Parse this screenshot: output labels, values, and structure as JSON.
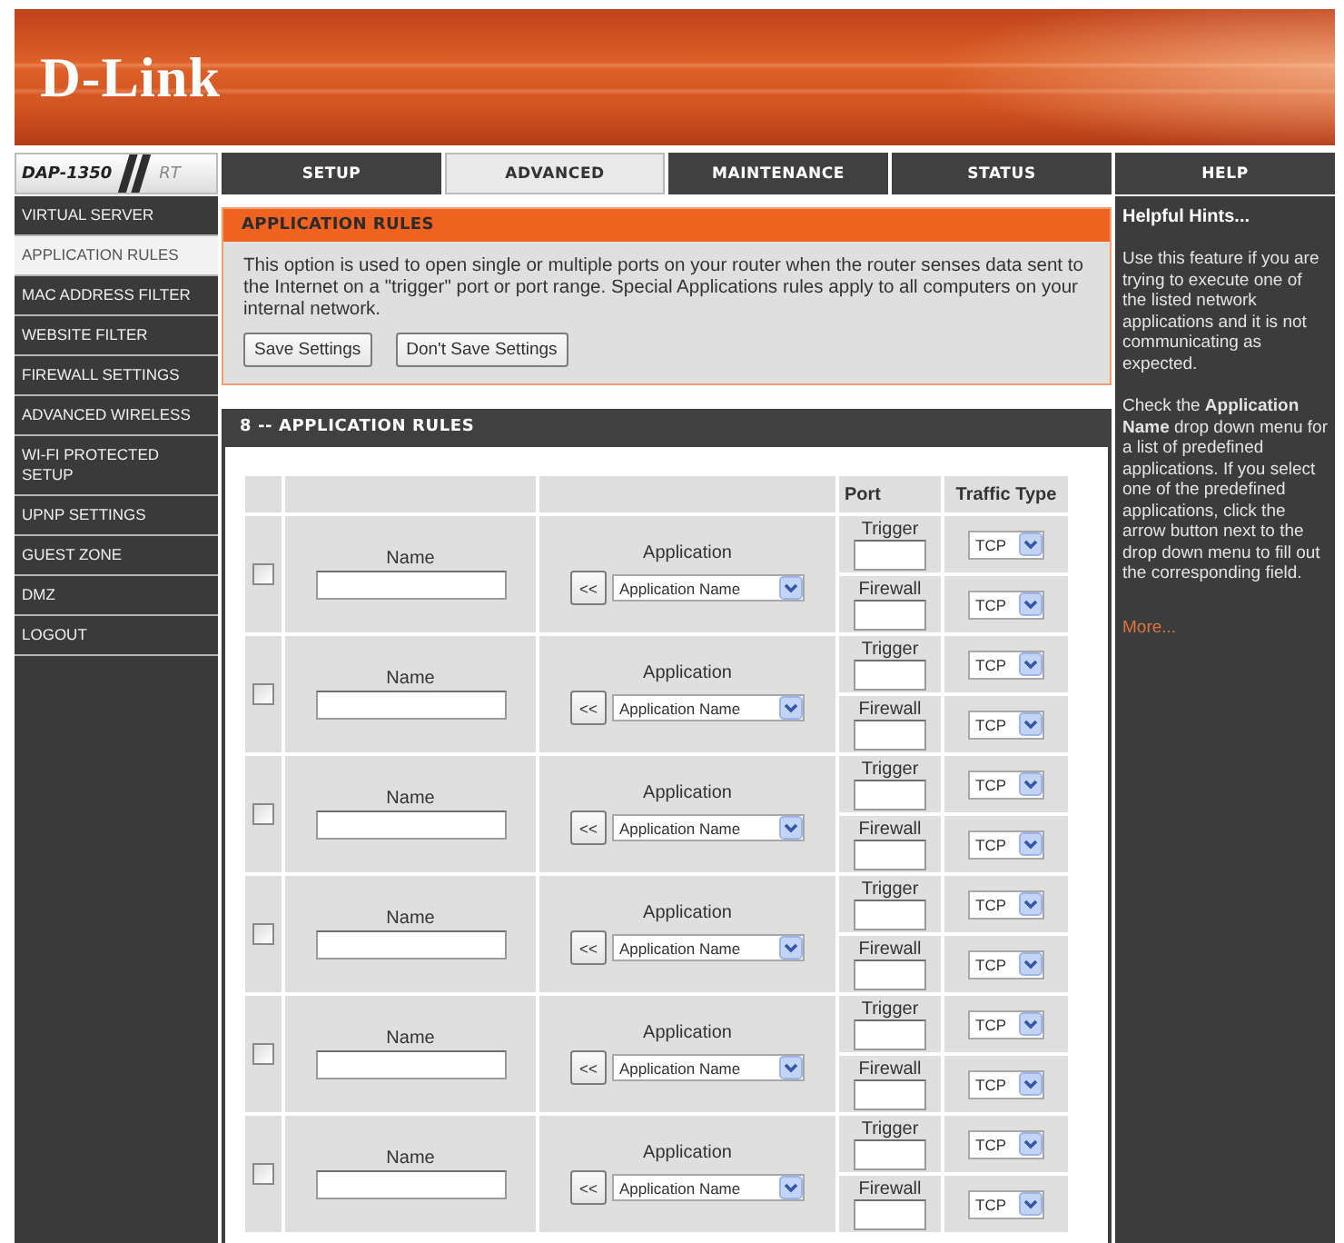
{
  "header": {
    "logo": "D-Link"
  },
  "model": {
    "name": "DAP-1350",
    "suffix": "RT"
  },
  "tabs": [
    {
      "label": "SETUP",
      "selected": false
    },
    {
      "label": "ADVANCED",
      "selected": true
    },
    {
      "label": "MAINTENANCE",
      "selected": false
    },
    {
      "label": "STATUS",
      "selected": false
    },
    {
      "label": "HELP",
      "selected": false
    }
  ],
  "sidebar": {
    "items": [
      {
        "label": "VIRTUAL SERVER",
        "selected": false
      },
      {
        "label": "APPLICATION RULES",
        "selected": true
      },
      {
        "label": "MAC ADDRESS FILTER",
        "selected": false
      },
      {
        "label": "WEBSITE FILTER",
        "selected": false
      },
      {
        "label": "FIREWALL SETTINGS",
        "selected": false
      },
      {
        "label": "ADVANCED WIRELESS",
        "selected": false
      },
      {
        "label": "WI-FI PROTECTED SETUP",
        "selected": false
      },
      {
        "label": "UPNP SETTINGS",
        "selected": false
      },
      {
        "label": "GUEST ZONE",
        "selected": false
      },
      {
        "label": "DMZ",
        "selected": false
      },
      {
        "label": "LOGOUT",
        "selected": false
      }
    ]
  },
  "intro": {
    "title": "APPLICATION RULES",
    "text": "This option is used to open single or multiple ports on your router when the router senses data sent to the Internet on a \"trigger\" port or port range. Special Applications rules apply to all computers on your internal network.",
    "buttons": [
      "Save Settings",
      "Don't Save Settings"
    ]
  },
  "rules": {
    "title": "8 -- APPLICATION RULES",
    "columns": {
      "port": "Port",
      "traffic_type": "Traffic Type"
    },
    "rows": [
      {
        "checked": false,
        "name_label": "Name",
        "application_label": "Application",
        "fill_button": "<<",
        "application": "Application Name",
        "trigger_label": "Trigger",
        "firewall_label": "Firewall",
        "trigger_protocol": "TCP",
        "firewall_protocol": "TCP"
      },
      {
        "checked": false,
        "name_label": "Name",
        "application_label": "Application",
        "fill_button": "<<",
        "application": "Application Name",
        "trigger_label": "Trigger",
        "firewall_label": "Firewall",
        "trigger_protocol": "TCP",
        "firewall_protocol": "TCP"
      },
      {
        "checked": false,
        "name_label": "Name",
        "application_label": "Application",
        "fill_button": "<<",
        "application": "Application Name",
        "trigger_label": "Trigger",
        "firewall_label": "Firewall",
        "trigger_protocol": "TCP",
        "firewall_protocol": "TCP"
      },
      {
        "checked": false,
        "name_label": "Name",
        "application_label": "Application",
        "fill_button": "<<",
        "application": "Application Name",
        "trigger_label": "Trigger",
        "firewall_label": "Firewall",
        "trigger_protocol": "TCP",
        "firewall_protocol": "TCP"
      },
      {
        "checked": false,
        "name_label": "Name",
        "application_label": "Application",
        "fill_button": "<<",
        "application": "Application Name",
        "trigger_label": "Trigger",
        "firewall_label": "Firewall",
        "trigger_protocol": "TCP",
        "firewall_protocol": "TCP"
      },
      {
        "checked": false,
        "name_label": "Name",
        "application_label": "Application",
        "fill_button": "<<",
        "application": "Application Name",
        "trigger_label": "Trigger",
        "firewall_label": "Firewall",
        "trigger_protocol": "TCP",
        "firewall_protocol": "TCP"
      }
    ]
  },
  "help": {
    "title": "Helpful Hints...",
    "paragraphs": [
      "Use this feature if you are trying to execute one of the listed network applications and it is not communicating as expected.",
      "Check the **Application Name** drop down menu for a list of predefined applications. If you select one of the predefined applications, click the arrow button next to the drop down menu to fill out the corresponding field."
    ],
    "link": "More..."
  }
}
